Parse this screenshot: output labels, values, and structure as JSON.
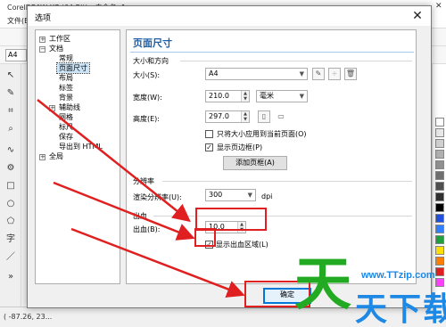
{
  "app": {
    "title": "CorelDRAW X7 (64-Bit) - 未命名 -1",
    "menu_first": "文件(E)",
    "paper_value": "A4",
    "status_text": "( -87.26,  23...",
    "toolbox_glyph": "字"
  },
  "dialog": {
    "title": "选项",
    "close_symbol": "✕"
  },
  "tree": {
    "items": [
      {
        "label": "工作区",
        "expander": "+"
      },
      {
        "label": "文档",
        "expander": "−"
      },
      {
        "label": "常规"
      },
      {
        "label": "页面尺寸"
      },
      {
        "label": "布局"
      },
      {
        "label": "标签"
      },
      {
        "label": "背景"
      },
      {
        "label": "辅助线",
        "expander": "+"
      },
      {
        "label": "网格"
      },
      {
        "label": "标尺"
      },
      {
        "label": "保存"
      },
      {
        "label": "导出到 HTML"
      },
      {
        "label": "全局",
        "expander": "+"
      }
    ]
  },
  "panel": {
    "title": "页面尺寸",
    "size_section": "大小和方向",
    "size_label": "大小(S):",
    "size_value": "A4",
    "width_label": "宽度(W):",
    "width_value": "210.0",
    "unit_value": "毫米",
    "height_label": "高度(E):",
    "height_value": "297.0",
    "only_current_label": "只将大小应用到当前页面(O)",
    "only_current_checked": false,
    "show_border_label": "显示页边框(P)",
    "show_border_checked": true,
    "add_border_button": "添加页框(A)",
    "resolution_section": "分辨率",
    "render_res_label": "渲染分辨率(U):",
    "render_res_value": "300",
    "render_res_unit": "dpi",
    "bleed_section": "出血",
    "bleed_label": "出血(B):",
    "bleed_value": "10.0",
    "show_bleed_label": "显示出血区域(L)",
    "show_bleed_checked": true
  },
  "footer": {
    "ok_button": "确定"
  },
  "watermark": {
    "url": "www.TTzip.com",
    "text": "天下载",
    "big_glyph": "天"
  },
  "colors": {
    "annotation_red": "#e02020",
    "panel_title_blue": "#1d5fa6",
    "primary_button_border": "#0078d7"
  }
}
